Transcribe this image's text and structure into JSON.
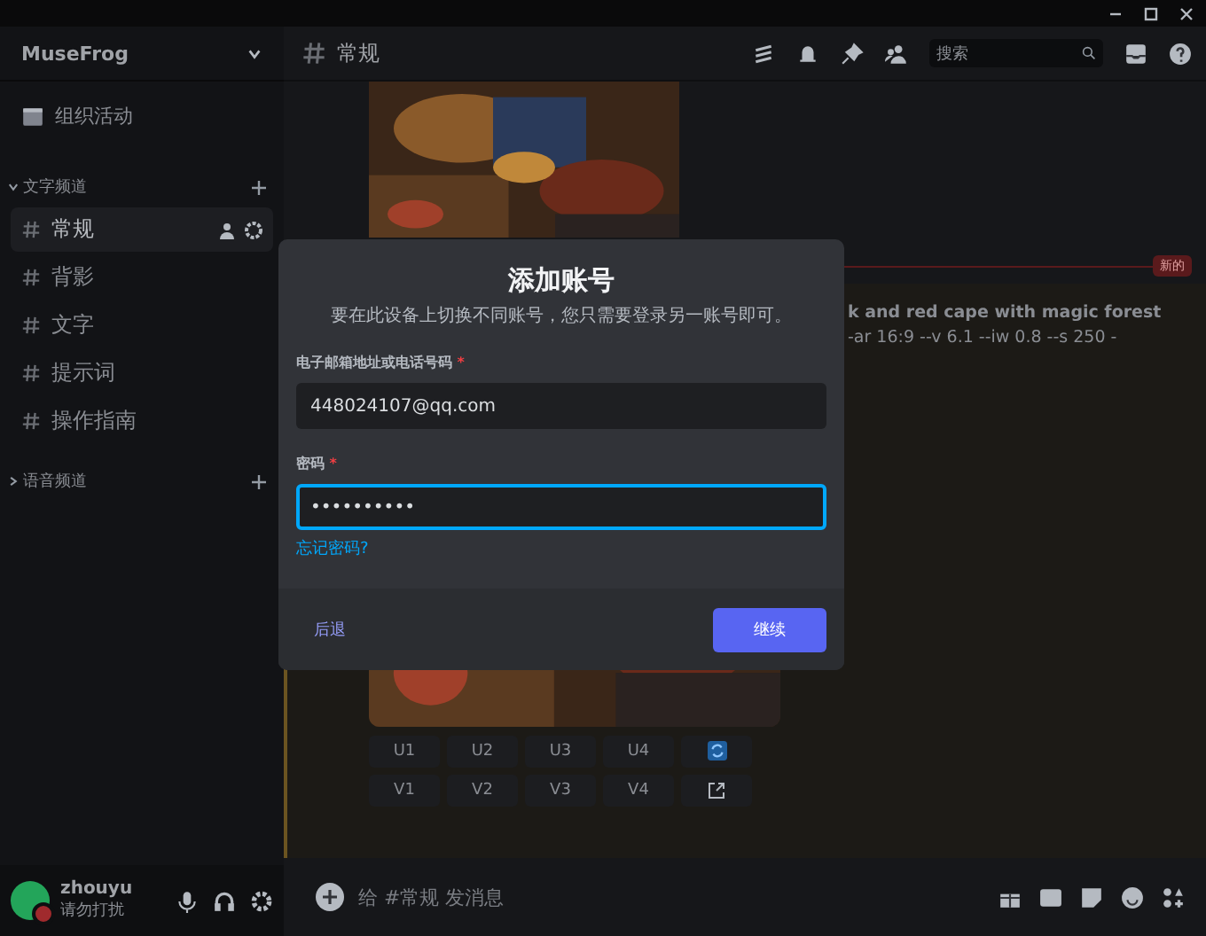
{
  "sidebar": {
    "server_name": "MuseFrog",
    "events_label": "组织活动",
    "categories": [
      {
        "name": "文字频道",
        "expanded": true,
        "channels": [
          {
            "name": "常规",
            "selected": true
          },
          {
            "name": "背影",
            "selected": false
          },
          {
            "name": "文字",
            "selected": false
          },
          {
            "name": "提示词",
            "selected": false
          },
          {
            "name": "操作指南",
            "selected": false
          }
        ]
      },
      {
        "name": "语音频道",
        "expanded": false
      }
    ]
  },
  "user_panel": {
    "name": "zhouyu",
    "status": "请勿打扰"
  },
  "header": {
    "channel": "常规",
    "search_placeholder": "搜索"
  },
  "messages": {
    "new_marker": "新的",
    "text_lines": [
      "k and red cape with magic forest",
      "-ar 16:9 --v 6.1 --iw 0.8 --s 250 -"
    ],
    "buttons": [
      {
        "kind": "text",
        "label": "U1"
      },
      {
        "kind": "text",
        "label": "U2"
      },
      {
        "kind": "text",
        "label": "U3"
      },
      {
        "kind": "text",
        "label": "U4"
      },
      {
        "kind": "refresh"
      },
      {
        "kind": "text",
        "label": "V1"
      },
      {
        "kind": "text",
        "label": "V2"
      },
      {
        "kind": "text",
        "label": "V3"
      },
      {
        "kind": "text",
        "label": "V4"
      },
      {
        "kind": "share"
      }
    ]
  },
  "composer": {
    "placeholder": "给 #常规 发消息"
  },
  "dialog": {
    "title": "添加账号",
    "subtitle": "要在此设备上切换不同账号，您只需要登录另一账号即可。",
    "fields": [
      {
        "label": "电子邮箱地址或电话号码",
        "required_mark": "*",
        "value": "448024107@qq.com",
        "focused": false
      },
      {
        "label": "密码",
        "required_mark": "*",
        "value": "••••••••••",
        "focused": true
      }
    ],
    "forgot_link": "忘记密码?",
    "back_button": "后退",
    "continue_button": "继续"
  }
}
